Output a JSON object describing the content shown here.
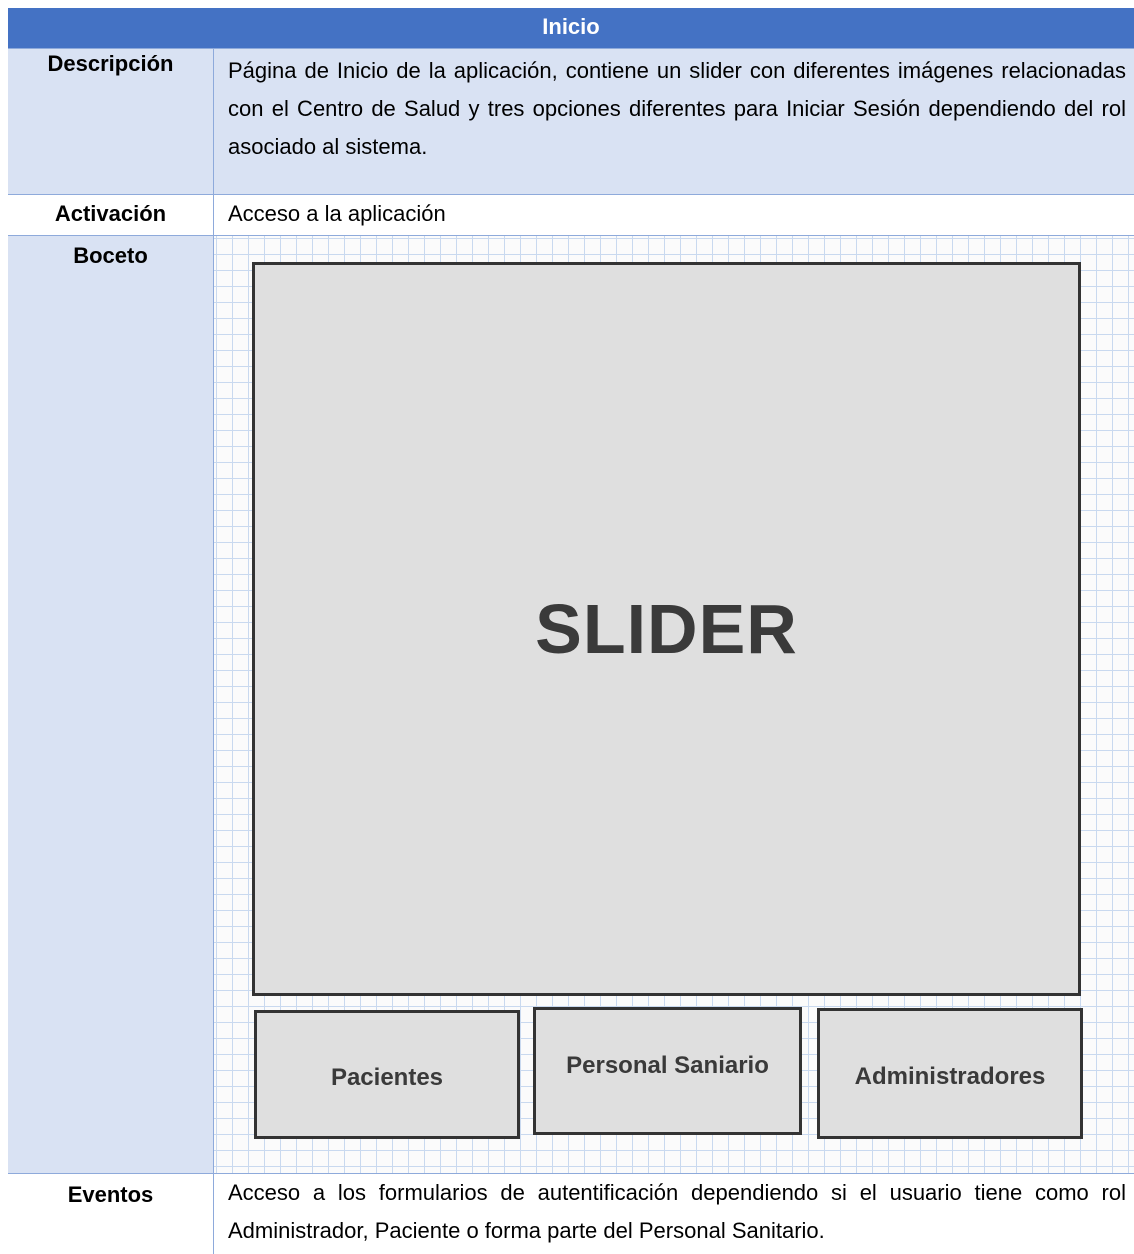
{
  "table": {
    "title": "Inicio",
    "rows": {
      "descripcion": {
        "label": "Descripción",
        "value": "Página de Inicio de la aplicación, contiene un slider con diferentes imágenes relacionadas con el Centro de Salud y tres opciones diferentes para Iniciar Sesión dependiendo del rol asociado al sistema."
      },
      "activacion": {
        "label": "Activación",
        "value": "Acceso a la aplicación"
      },
      "boceto": {
        "label": "Boceto",
        "slider_label": "SLIDER",
        "buttons": [
          "Pacientes",
          "Personal Saniario",
          "Administradores"
        ]
      },
      "eventos": {
        "label": "Eventos",
        "value": "Acceso a los formularios de autentificación dependiendo si el usuario tiene como rol Administrador, Paciente o forma parte del Personal Sanitario."
      }
    }
  },
  "colors": {
    "header": "#4472c4",
    "shaded_row": "#d9e2f3",
    "border": "#8eaadb",
    "sketch_box": "#dfdfdf"
  }
}
